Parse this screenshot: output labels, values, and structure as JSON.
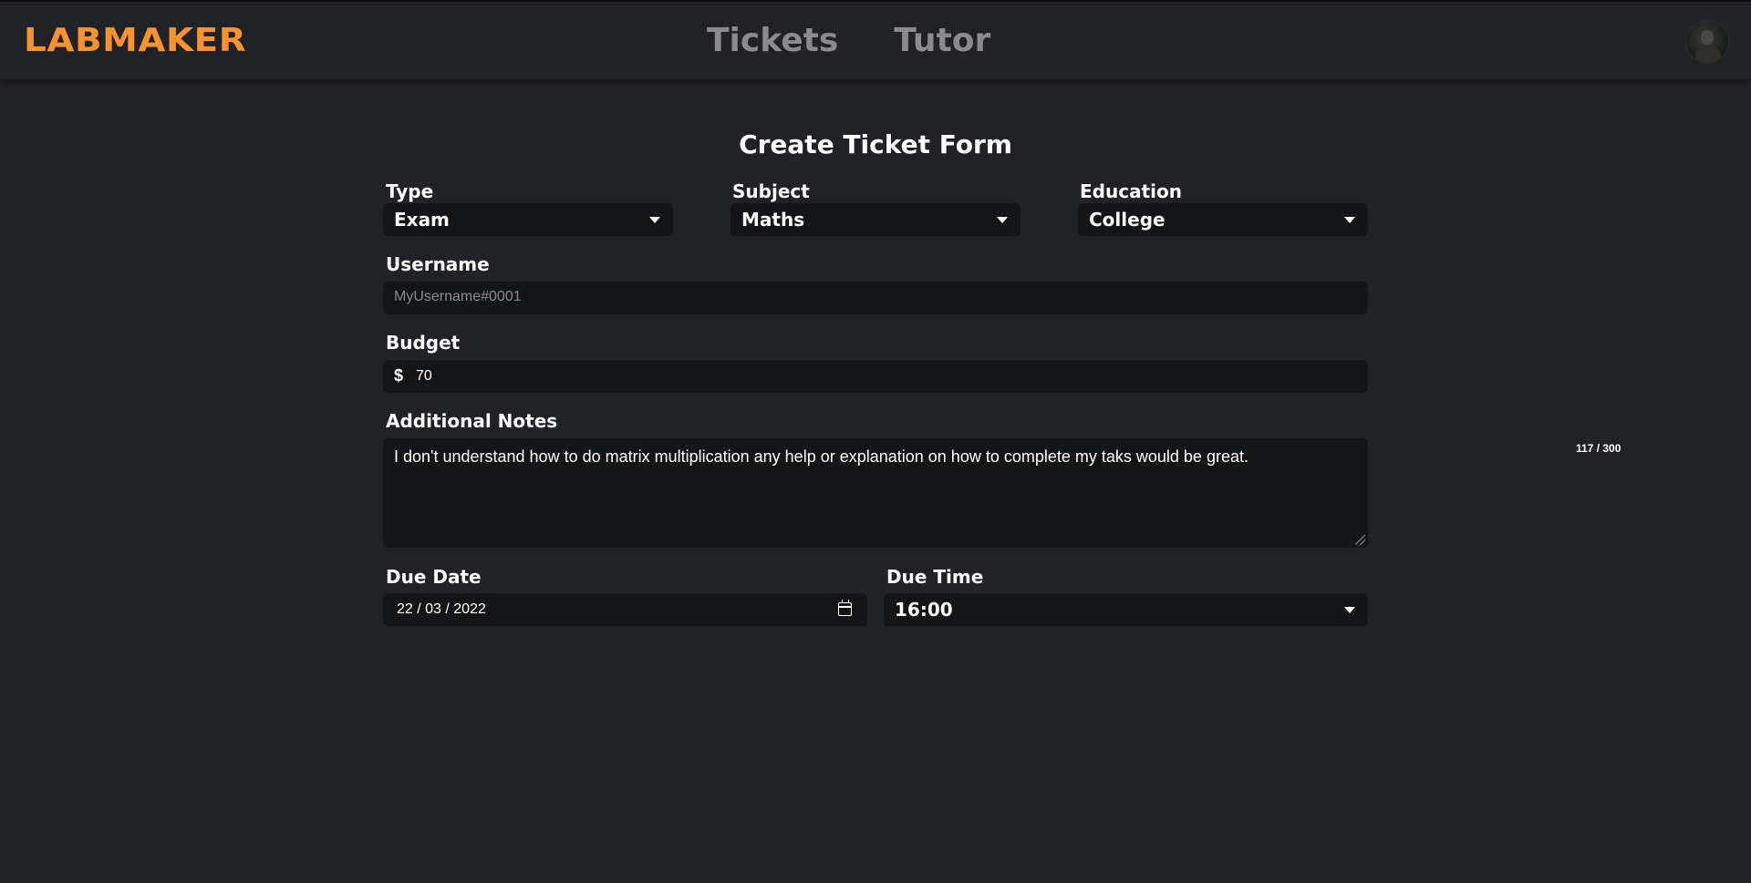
{
  "nav": {
    "logo": "LABMAKER",
    "links": [
      "Tickets",
      "Tutor"
    ]
  },
  "form": {
    "title": "Create Ticket Form",
    "type": {
      "label": "Type",
      "value": "Exam"
    },
    "subject": {
      "label": "Subject",
      "value": "Maths"
    },
    "education": {
      "label": "Education",
      "value": "College"
    },
    "username": {
      "label": "Username",
      "placeholder": "MyUsername#0001",
      "value": ""
    },
    "budget": {
      "label": "Budget",
      "currency": "$",
      "value": "70"
    },
    "notes": {
      "label": "Additional Notes",
      "value": "I don't understand how to do matrix multiplication any help or explanation on how to complete my taks would be great.",
      "counter": "117 / 300"
    },
    "due_date": {
      "label": "Due Date",
      "value": "22 / 03 / 2022"
    },
    "due_time": {
      "label": "Due Time",
      "value": "16:00"
    }
  },
  "colors": {
    "background": "#212226",
    "field": "#141517",
    "brand": "#f7932f",
    "nav_link": "#8b8b8d"
  }
}
